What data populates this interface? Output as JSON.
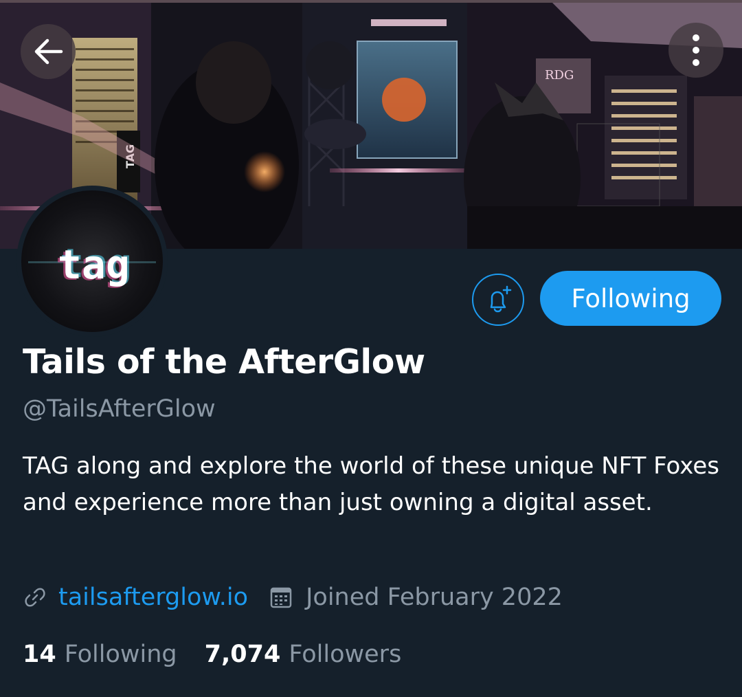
{
  "header": {
    "back_icon": "arrow-left-icon",
    "more_icon": "more-vertical-icon",
    "banner_logo_text": "RDG",
    "banner_tag_text": "TAG"
  },
  "avatar": {
    "logo_text": "tag"
  },
  "actions": {
    "notify_icon": "bell-plus-icon",
    "follow_label": "Following"
  },
  "profile": {
    "display_name": "Tails of the AfterGlow",
    "handle": "@TailsAfterGlow",
    "bio": "TAG along and explore the world of these unique NFT Foxes and experience more than just owning a digital asset.",
    "website": "tailsafterglow.io",
    "joined": "Joined February 2022"
  },
  "stats": {
    "following_count": "14",
    "following_label": "Following",
    "followers_count": "7,074",
    "followers_label": "Followers"
  },
  "colors": {
    "background": "#15202b",
    "accent": "#1d9bf0",
    "secondary_text": "#8b98a5"
  }
}
